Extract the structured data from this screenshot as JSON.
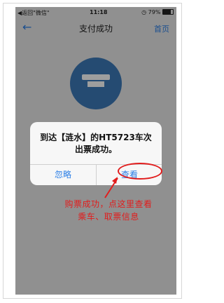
{
  "status_bar": {
    "back_app": "◀返回\"微信\"",
    "time": "11:18",
    "battery_text": "79%"
  },
  "nav": {
    "back_icon": "back-arrow-icon",
    "title": "支付成功",
    "home_label": "首页"
  },
  "dialog": {
    "message": "到达【涟水】的HT5723车次出票成功。",
    "ignore_label": "忽略",
    "view_label": "查看"
  },
  "annotation": {
    "text": "购票成功，点这里查看乘车、取票信息"
  },
  "colors": {
    "accent_blue": "#2a7ee6",
    "annotation_red": "#e11d1d",
    "success_circle": "#3d79b8"
  }
}
